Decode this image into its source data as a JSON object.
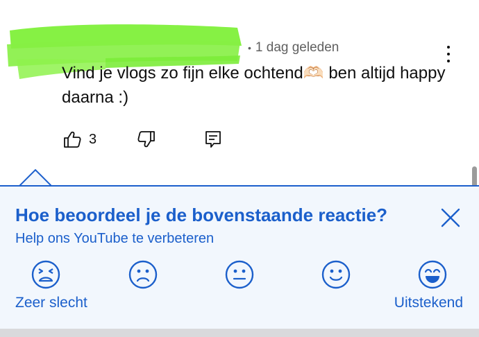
{
  "comment": {
    "time_ago": "1 dag geleden",
    "text": "Vind je vlogs zo fijn elke ochtend🫶🏻 ben altijd happy daarna :)",
    "like_count": "3",
    "redaction_color": "#7ff03a"
  },
  "survey": {
    "title": "Hoe beoordeel je de bovenstaande reactie?",
    "subtitle": "Help ons YouTube te verbeteren",
    "label_low": "Zeer slecht",
    "label_high": "Uitstekend",
    "accent_color": "#1b5fcb",
    "options": [
      {
        "icon": "very-bad-face-icon"
      },
      {
        "icon": "bad-face-icon"
      },
      {
        "icon": "neutral-face-icon"
      },
      {
        "icon": "good-face-icon"
      },
      {
        "icon": "excellent-face-icon"
      }
    ]
  }
}
